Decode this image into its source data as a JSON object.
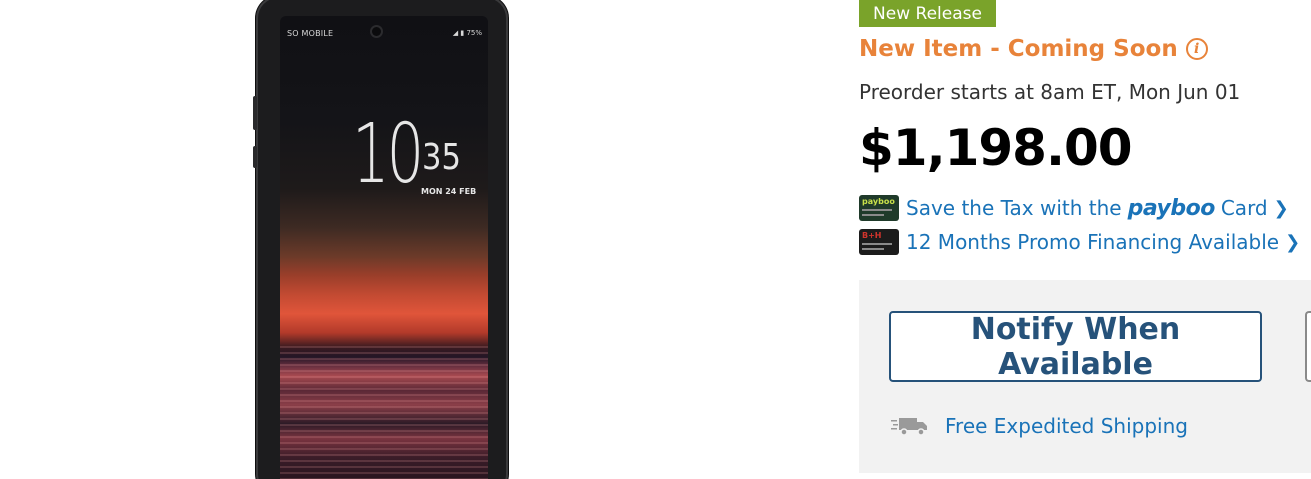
{
  "product_image": {
    "status_carrier": "SO MOBILE",
    "status_battery": "75%",
    "clock_hour": "10",
    "clock_minute": "35",
    "clock_date": "MON 24 FEB"
  },
  "badge": {
    "label": "New Release",
    "color": "#7aa32a"
  },
  "availability": {
    "label": "New Item - Coming Soon",
    "info_icon": "info-icon",
    "color": "#e8833a"
  },
  "preorder_text": "Preorder starts at 8am ET, Mon Jun 01",
  "price": "$1,198.00",
  "promos": {
    "tax": {
      "prefix": "Save the Tax with the",
      "brand": "payboo",
      "suffix": "Card",
      "card_label": "payboo",
      "chevron_icon": "chevron-right-icon"
    },
    "financing": {
      "label": "12 Months Promo Financing Available",
      "card_label": "B+H",
      "chevron_icon": "chevron-right-icon"
    }
  },
  "actions": {
    "notify_label": "Notify When Available",
    "shipping_label": "Free Expedited Shipping",
    "shipping_icon": "truck-icon"
  },
  "colors": {
    "link": "#1a73b8",
    "button_border": "#26527a",
    "panel_bg": "#f2f2f2"
  }
}
